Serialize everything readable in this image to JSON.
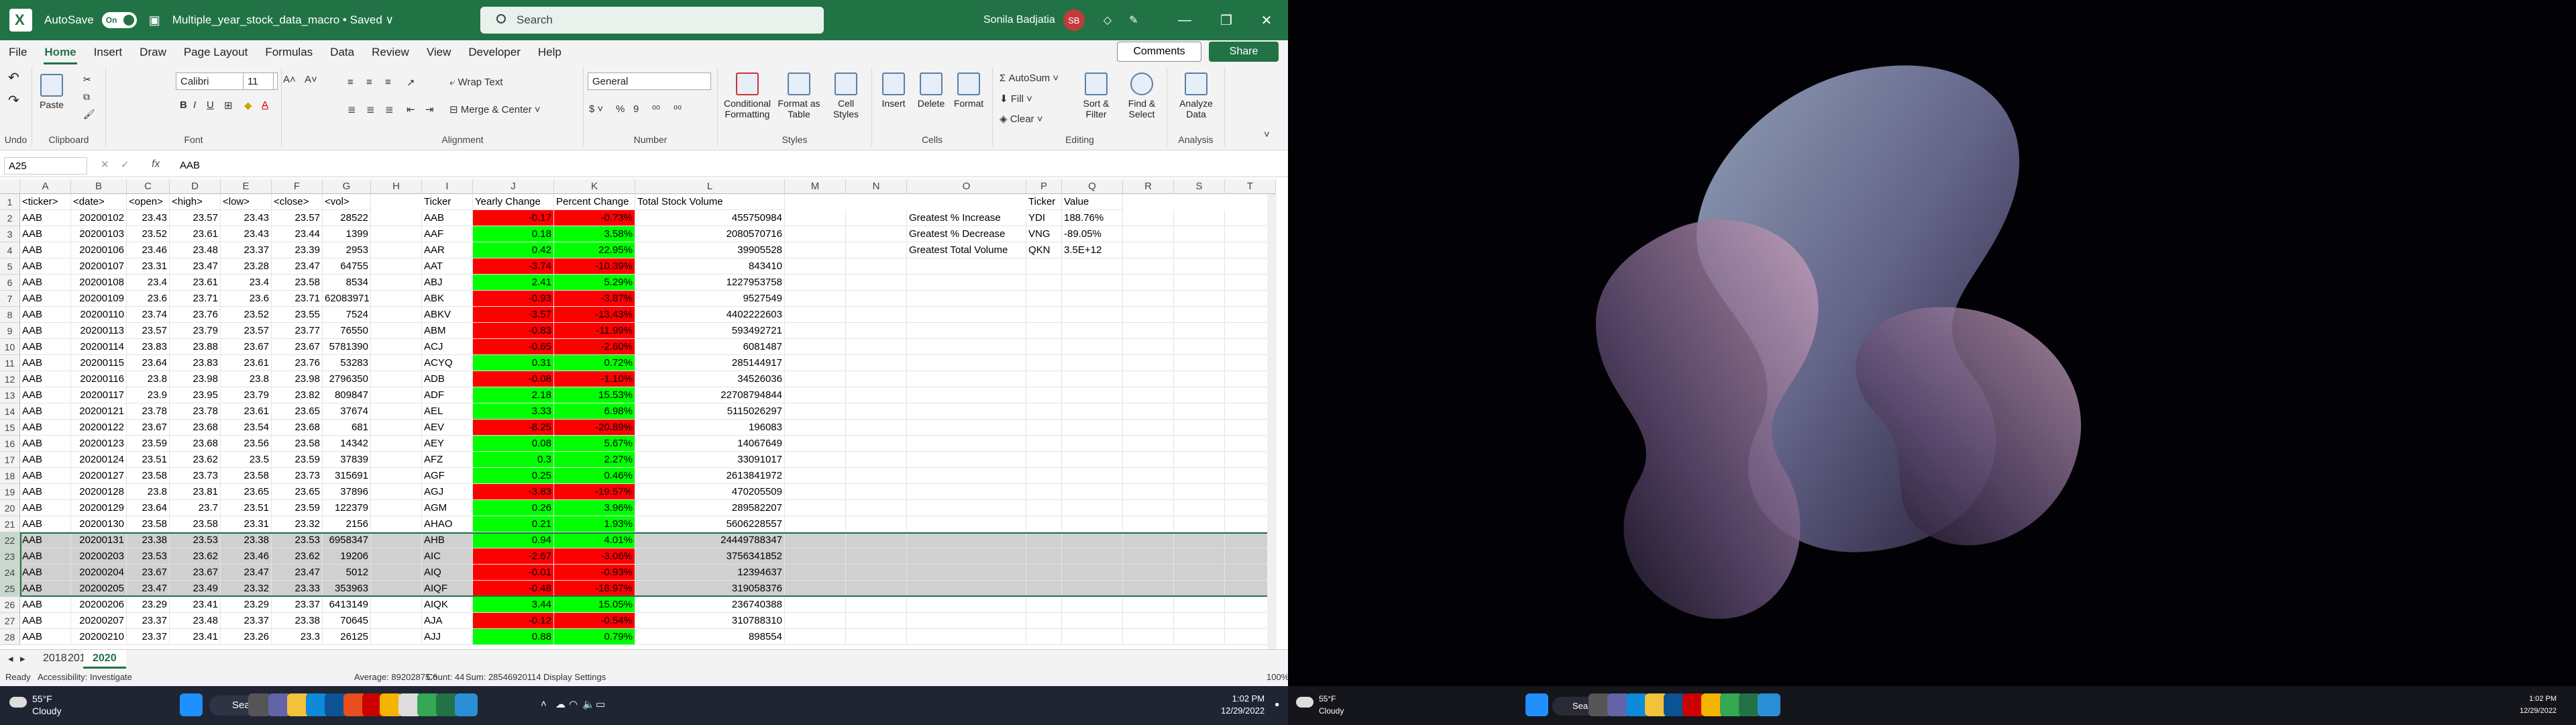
{
  "window": {
    "autosave_label": "AutoSave",
    "autosave_state": "On",
    "file_name": "Multiple_year_stock_data_macro • Saved ∨",
    "search_placeholder": "Search",
    "user_name": "Sonila Badjatia",
    "user_initials": "SB"
  },
  "menu": [
    "File",
    "Home",
    "Insert",
    "Draw",
    "Page Layout",
    "Formulas",
    "Data",
    "Review",
    "View",
    "Developer",
    "Help"
  ],
  "menu_active": "Home",
  "buttons": {
    "comments": "Comments",
    "share": "Share"
  },
  "ribbon": {
    "undo_label": "Undo",
    "clipboard_label": "Clipboard",
    "paste_label": "Paste",
    "font_label": "Font",
    "font_name": "Calibri",
    "font_size": "11",
    "alignment_label": "Alignment",
    "wrap_text": "Wrap Text",
    "merge_center": "Merge & Center",
    "number_label": "Number",
    "number_format": "General",
    "styles_label": "Styles",
    "conditional_formatting": "Conditional Formatting",
    "format_as_table": "Format as Table",
    "cell_styles": "Cell Styles",
    "cells_label": "Cells",
    "insert": "Insert",
    "delete": "Delete",
    "format": "Format",
    "editing_label": "Editing",
    "autosum": "AutoSum",
    "fill": "Fill",
    "clear": "Clear",
    "sort_filter": "Sort & Filter",
    "find_select": "Find & Select",
    "analysis_label": "Analysis",
    "analyze_data": "Analyze Data"
  },
  "formula_bar": {
    "name_box": "A25",
    "fx": "fx",
    "content": "AAB"
  },
  "columns": [
    "A",
    "B",
    "C",
    "D",
    "E",
    "F",
    "G",
    "H",
    "I",
    "J",
    "K",
    "L",
    "M",
    "N",
    "O",
    "P",
    "Q",
    "R",
    "S",
    "T"
  ],
  "header_row": [
    "<ticker>",
    "<date>",
    "<open>",
    "<high>",
    "<low>",
    "<close>",
    "<vol>",
    "",
    "Ticker",
    "Yearly Change",
    "Percent Change",
    "Total Stock Volume",
    "",
    "",
    "",
    "Ticker",
    "Value"
  ],
  "rows": [
    [
      "AAB",
      "20200102",
      "23.43",
      "23.57",
      "23.43",
      "23.57",
      "28522",
      "",
      "AAB",
      "-0.17",
      "-0.73%",
      "455750984"
    ],
    [
      "AAB",
      "20200103",
      "23.52",
      "23.61",
      "23.43",
      "23.44",
      "1399",
      "",
      "AAF",
      "0.18",
      "3.58%",
      "2080570716"
    ],
    [
      "AAB",
      "20200106",
      "23.46",
      "23.48",
      "23.37",
      "23.39",
      "2953",
      "",
      "AAR",
      "0.42",
      "22.95%",
      "39905528"
    ],
    [
      "AAB",
      "20200107",
      "23.31",
      "23.47",
      "23.28",
      "23.47",
      "64755",
      "",
      "AAT",
      "-3.74",
      "-10.39%",
      "843410"
    ],
    [
      "AAB",
      "20200108",
      "23.4",
      "23.61",
      "23.4",
      "23.58",
      "8534",
      "",
      "ABJ",
      "2.41",
      "5.29%",
      "1227953758"
    ],
    [
      "AAB",
      "20200109",
      "23.6",
      "23.71",
      "23.6",
      "23.71",
      "62083971",
      "",
      "ABK",
      "-0.93",
      "-3.87%",
      "9527549"
    ],
    [
      "AAB",
      "20200110",
      "23.74",
      "23.76",
      "23.52",
      "23.55",
      "7524",
      "",
      "ABKV",
      "-3.57",
      "-13.43%",
      "4402222603"
    ],
    [
      "AAB",
      "20200113",
      "23.57",
      "23.79",
      "23.57",
      "23.77",
      "76550",
      "",
      "ABM",
      "-0.83",
      "-11.99%",
      "593492721"
    ],
    [
      "AAB",
      "20200114",
      "23.83",
      "23.88",
      "23.67",
      "23.67",
      "5781390",
      "",
      "ACJ",
      "-0.65",
      "-2.60%",
      "6081487"
    ],
    [
      "AAB",
      "20200115",
      "23.64",
      "23.83",
      "23.61",
      "23.76",
      "53283",
      "",
      "ACYQ",
      "0.31",
      "0.72%",
      "285144917"
    ],
    [
      "AAB",
      "20200116",
      "23.8",
      "23.98",
      "23.8",
      "23.98",
      "2796350",
      "",
      "ADB",
      "-0.08",
      "-1.10%",
      "34526036"
    ],
    [
      "AAB",
      "20200117",
      "23.9",
      "23.95",
      "23.79",
      "23.82",
      "809847",
      "",
      "ADF",
      "2.18",
      "15.53%",
      "22708794844"
    ],
    [
      "AAB",
      "20200121",
      "23.78",
      "23.78",
      "23.61",
      "23.65",
      "37674",
      "",
      "AEL",
      "3.33",
      "6.98%",
      "5115026297"
    ],
    [
      "AAB",
      "20200122",
      "23.67",
      "23.68",
      "23.54",
      "23.68",
      "681",
      "",
      "AEV",
      "-8.25",
      "-20.89%",
      "196083"
    ],
    [
      "AAB",
      "20200123",
      "23.59",
      "23.68",
      "23.56",
      "23.58",
      "14342",
      "",
      "AEY",
      "0.08",
      "5.67%",
      "14067649"
    ],
    [
      "AAB",
      "20200124",
      "23.51",
      "23.62",
      "23.5",
      "23.59",
      "37839",
      "",
      "AFZ",
      "0.3",
      "2.27%",
      "33091017"
    ],
    [
      "AAB",
      "20200127",
      "23.58",
      "23.73",
      "23.58",
      "23.73",
      "315691",
      "",
      "AGF",
      "0.25",
      "0.46%",
      "2613841972"
    ],
    [
      "AAB",
      "20200128",
      "23.8",
      "23.81",
      "23.65",
      "23.65",
      "37896",
      "",
      "AGJ",
      "-3.83",
      "-19.57%",
      "470205509"
    ],
    [
      "AAB",
      "20200129",
      "23.64",
      "23.7",
      "23.51",
      "23.59",
      "122379",
      "",
      "AGM",
      "0.26",
      "3.96%",
      "289582207"
    ],
    [
      "AAB",
      "20200130",
      "23.58",
      "23.58",
      "23.31",
      "23.32",
      "2156",
      "",
      "AHAO",
      "0.21",
      "1.93%",
      "5606228557"
    ],
    [
      "AAB",
      "20200131",
      "23.38",
      "23.53",
      "23.38",
      "23.53",
      "6958347",
      "",
      "AHB",
      "0.94",
      "4.01%",
      "24449788347"
    ],
    [
      "AAB",
      "20200203",
      "23.53",
      "23.62",
      "23.46",
      "23.62",
      "19206",
      "",
      "AIC",
      "-2.67",
      "-3.06%",
      "3756341852"
    ],
    [
      "AAB",
      "20200204",
      "23.67",
      "23.67",
      "23.47",
      "23.47",
      "5012",
      "",
      "AIQ",
      "-0.01",
      "-0.93%",
      "12394637"
    ],
    [
      "AAB",
      "20200205",
      "23.47",
      "23.49",
      "23.32",
      "23.33",
      "353963",
      "",
      "AIQF",
      "-0.48",
      "-18.97%",
      "319058376"
    ],
    [
      "AAB",
      "20200206",
      "23.29",
      "23.41",
      "23.29",
      "23.37",
      "6413149",
      "",
      "AIQK",
      "3.44",
      "15.05%",
      "236740388"
    ],
    [
      "AAB",
      "20200207",
      "23.37",
      "23.48",
      "23.37",
      "23.38",
      "70645",
      "",
      "AJA",
      "-0.12",
      "-0.54%",
      "310788310"
    ],
    [
      "AAB",
      "20200210",
      "23.37",
      "23.41",
      "23.26",
      "23.3",
      "26125",
      "",
      "AJJ",
      "0.88",
      "0.79%",
      "898554"
    ]
  ],
  "summary": [
    {
      "label": "Greatest % Increase",
      "ticker": "YDI",
      "value": "188.76%"
    },
    {
      "label": "Greatest % Decrease",
      "ticker": "VNG",
      "value": "-89.05%"
    },
    {
      "label": "Greatest Total Volume",
      "ticker": "QKN",
      "value": "3.5E+12"
    }
  ],
  "sheets": [
    "2018",
    "2019",
    "2020"
  ],
  "active_sheet": "2020",
  "status": {
    "ready": "Ready",
    "accessibility": "Accessibility: Investigate",
    "average": "Average: 89202875.6",
    "count": "Count: 44",
    "sum": "Sum: 28546920114",
    "display_settings": "Display Settings",
    "zoom": "100%"
  },
  "taskbar": {
    "weather_temp": "55°F",
    "weather_desc": "Cloudy",
    "search": "Search",
    "time": "1:02 PM",
    "date": "12/29/2022"
  },
  "colors": {
    "excel_green": "#217346",
    "positive": "#00ff00",
    "negative": "#ff0000"
  }
}
